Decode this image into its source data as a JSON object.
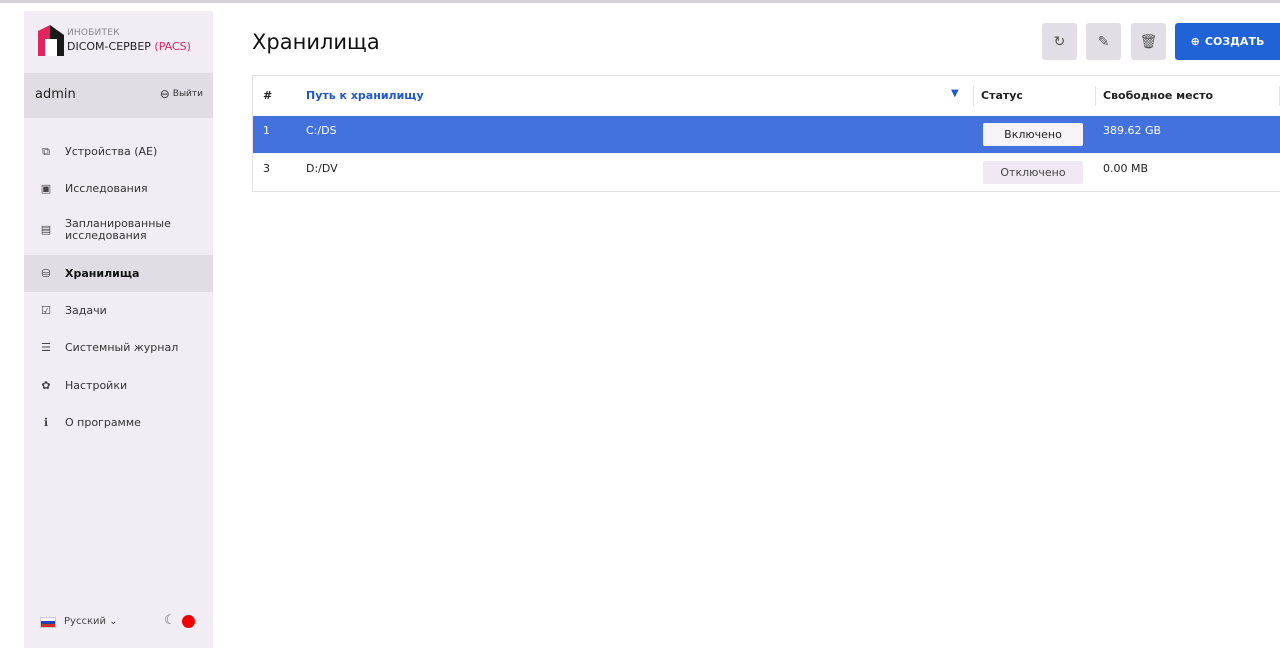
{
  "brand": {
    "company": "ИНОБИТЕК",
    "product": "DICOM-СЕРВЕР",
    "product_suffix": "(PACS)"
  },
  "user": {
    "name": "admin",
    "logout_label": "Выйти"
  },
  "nav": [
    {
      "label": "Устройства (AE)",
      "icon": "devices-icon"
    },
    {
      "label": "Исследования",
      "icon": "studies-icon"
    },
    {
      "label": "Запланированные исследования",
      "icon": "scheduled-studies-icon"
    },
    {
      "label": "Хранилища",
      "icon": "storage-icon",
      "active": true
    },
    {
      "label": "Задачи",
      "icon": "tasks-icon"
    },
    {
      "label": "Системный журнал",
      "icon": "system-log-icon"
    },
    {
      "label": "Настройки",
      "icon": "settings-icon"
    },
    {
      "label": "О программе",
      "icon": "about-icon"
    }
  ],
  "footer": {
    "language": "Русский",
    "theme_icon": "moon-icon"
  },
  "page": {
    "title": "Хранилища"
  },
  "toolbar": {
    "refresh_icon": "refresh-icon",
    "edit_icon": "pencil-icon",
    "delete_icon": "trash-icon",
    "create_label": "СОЗДАТЬ"
  },
  "table": {
    "columns": {
      "num": "#",
      "path": "Путь к хранилищу",
      "status": "Статус",
      "free_space": "Свободное место"
    },
    "sort": {
      "column": "path",
      "direction": "desc"
    },
    "rows": [
      {
        "num": "1",
        "path": "C:/DS",
        "status": "Включено",
        "free_space": "389.62 GB",
        "selected": true
      },
      {
        "num": "3",
        "path": "D:/DV",
        "status": "Отключено",
        "free_space": "0.00 MB",
        "selected": false
      }
    ]
  },
  "colors": {
    "accent": "#1f63d7",
    "selected_row": "#4372de",
    "sidebar_bg": "#f2ecf4",
    "brand_red": "#e0245e",
    "status_dot": "#f00000"
  }
}
